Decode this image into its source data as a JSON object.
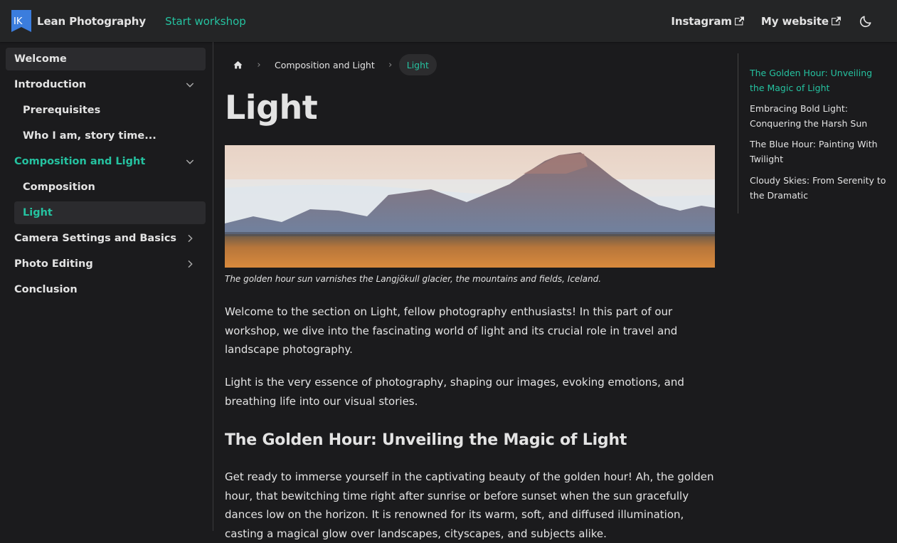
{
  "navbar": {
    "logo_text": "IK",
    "brand_title": "Lean Photography",
    "start_label": "Start workshop",
    "links": [
      {
        "label": "Instagram"
      },
      {
        "label": "My website"
      }
    ],
    "accent_color": "#25c2a0"
  },
  "sidebar": {
    "items": [
      {
        "label": "Welcome"
      },
      {
        "label": "Introduction"
      },
      {
        "label": "Prerequisites"
      },
      {
        "label": "Who I am, story time..."
      },
      {
        "label": "Composition and Light"
      },
      {
        "label": "Composition"
      },
      {
        "label": "Light"
      },
      {
        "label": "Camera Settings and Basics"
      },
      {
        "label": "Photo Editing"
      },
      {
        "label": "Conclusion"
      }
    ]
  },
  "breadcrumb": {
    "parent": "Composition and Light",
    "current": "Light"
  },
  "page": {
    "title": "Light",
    "caption": "The golden hour sun varnishes the Langjökull glacier, the mountains and fields, Iceland.",
    "para1": "Welcome to the section on Light, fellow photography enthusiasts! In this part of our workshop, we dive into the fascinating world of light and its crucial role in travel and landscape photography.",
    "para2": "Light is the very essence of photography, shaping our images, evoking emotions, and breathing life into our visual stories.",
    "section_heading": "The Golden Hour: Unveiling the Magic of Light",
    "para3": "Get ready to immerse yourself in the captivating beauty of the golden hour! Ah, the golden hour, that bewitching time right after sunrise or before sunset when the sun gracefully dances low on the horizon. It is renowned for its warm, soft, and diffused illumination, casting a magical glow over landscapes, cityscapes, and subjects alike."
  },
  "toc": {
    "items": [
      {
        "label": "The Golden Hour: Unveiling the Magic of Light"
      },
      {
        "label": "Embracing Bold Light: Conquering the Harsh Sun"
      },
      {
        "label": "The Blue Hour: Painting With Twilight"
      },
      {
        "label": "Cloudy Skies: From Serenity to the Dramatic"
      }
    ]
  }
}
